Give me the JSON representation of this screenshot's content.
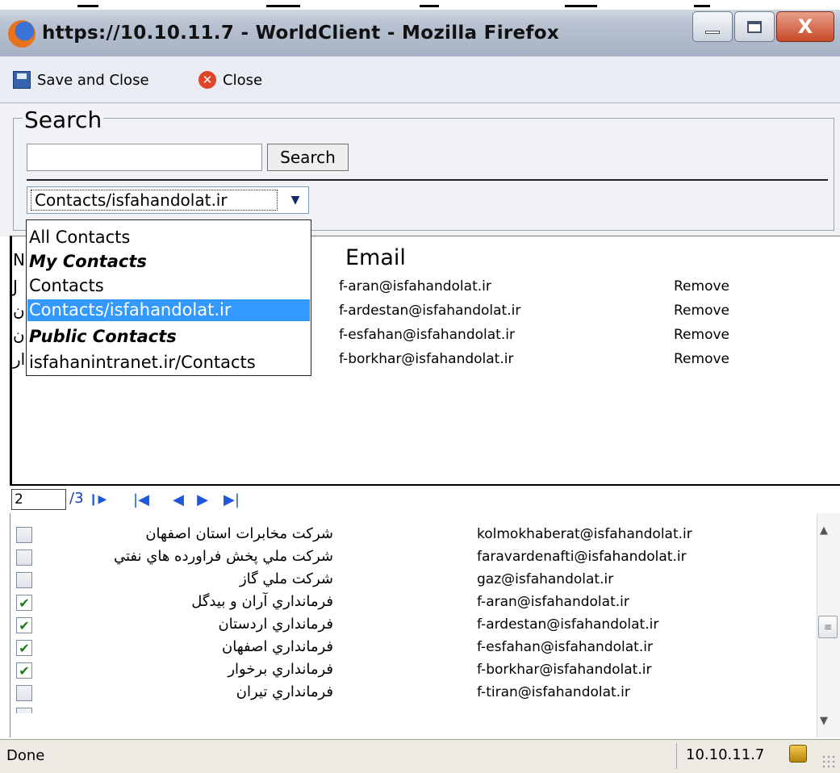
{
  "window": {
    "title": "https://10.10.11.7 - WorldClient - Mozilla Firefox",
    "close_glyph": "X"
  },
  "toolbar": {
    "save_close_label": "Save and Close",
    "close_label": "Close"
  },
  "search": {
    "legend": "Search",
    "input_value": "",
    "button_label": "Search",
    "folder_selected": "Contacts/isfahandolat.ir"
  },
  "folder_options": [
    {
      "label": "All Contacts",
      "style": "normal"
    },
    {
      "label": "My Contacts",
      "style": "group"
    },
    {
      "label": "Contacts",
      "style": "normal"
    },
    {
      "label": "Contacts/isfahandolat.ir",
      "style": "selected"
    },
    {
      "label": "Public Contacts",
      "style": "group"
    },
    {
      "label": "isfahanintranet.ir/Contacts",
      "style": "normal"
    }
  ],
  "contacts": {
    "email_header": "Email",
    "left_fragments": [
      "N",
      "J",
      "ن",
      "ن",
      "ار"
    ],
    "rows": [
      {
        "email": "f-aran@isfahandolat.ir",
        "action": "Remove"
      },
      {
        "email": "f-ardestan@isfahandolat.ir",
        "action": "Remove"
      },
      {
        "email": "f-esfahan@isfahandolat.ir",
        "action": "Remove"
      },
      {
        "email": "f-borkhar@isfahandolat.ir",
        "action": "Remove"
      }
    ]
  },
  "pager": {
    "current_page": "2",
    "total": "/3"
  },
  "recipients": [
    {
      "name": "شركت مخابرات استان اصفهان",
      "email": "kolmokhaberat@isfahandolat.ir",
      "checked": false
    },
    {
      "name": "شركت ملي پخش فراورده هاي نفتي",
      "email": "faravardenafti@isfahandolat.ir",
      "checked": false
    },
    {
      "name": "شركت ملي گاز",
      "email": "gaz@isfahandolat.ir",
      "checked": false
    },
    {
      "name": "فرمانداري آران و بيدگل",
      "email": "f-aran@isfahandolat.ir",
      "checked": true
    },
    {
      "name": "فرمانداري اردستان",
      "email": "f-ardestan@isfahandolat.ir",
      "checked": true
    },
    {
      "name": "فرمانداري اصفهان",
      "email": "f-esfahan@isfahandolat.ir",
      "checked": true
    },
    {
      "name": "فرمانداري برخوار",
      "email": "f-borkhar@isfahandolat.ir",
      "checked": true
    },
    {
      "name": "فرمانداري تيران",
      "email": "f-tiran@isfahandolat.ir",
      "checked": false
    }
  ],
  "status": {
    "text": "Done",
    "host": "10.10.11.7"
  },
  "colors": {
    "selection": "#3399ff",
    "titlebar": "#aab5c6",
    "link_blue": "#1f57d6"
  }
}
